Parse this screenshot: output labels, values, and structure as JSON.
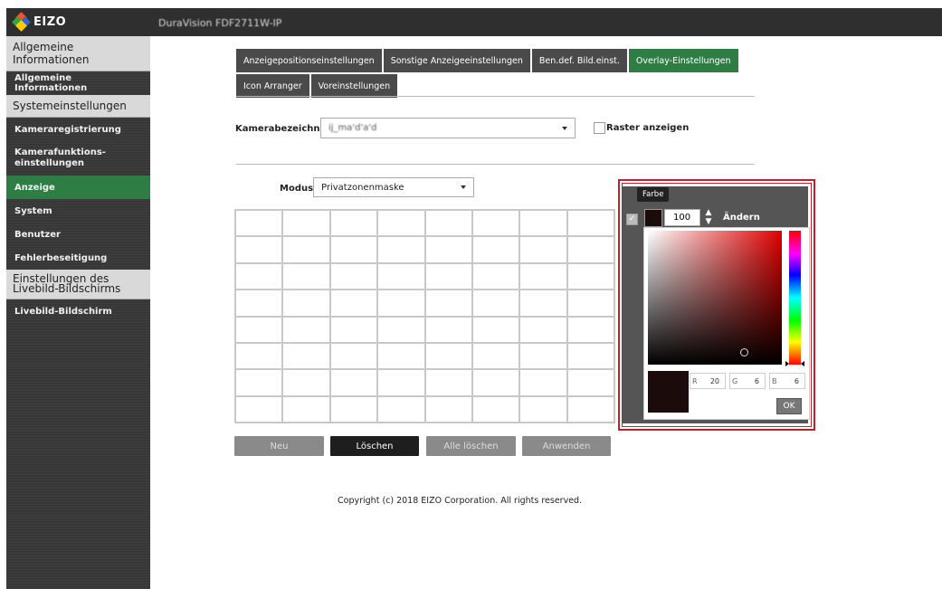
{
  "header": {
    "logo_text": "EIZO",
    "device_name": "DuraVision FDF2711W-IP"
  },
  "sidebar": {
    "sections": [
      {
        "label": "Allgemeine Informationen",
        "items": [
          "Allgemeine Informationen"
        ]
      },
      {
        "label": "Systemeinstellungen",
        "items": [
          "Kameraregistrierung",
          "Kamerafunktions-\neinstellungen",
          "Anzeige",
          "System",
          "Benutzer",
          "Fehlerbeseitigung"
        ]
      },
      {
        "label": "Einstellungen des Livebild-Bildschirms",
        "items": [
          "Livebild-Bildschirm"
        ]
      }
    ],
    "active_item": "Anzeige"
  },
  "tabs": {
    "row1": [
      "Anzeigepositionseinstellungen",
      "Sonstige Anzeigeeinstellungen",
      "Ben.def. Bild.einst.",
      "Overlay-Einstellungen"
    ],
    "row2": [
      "Icon Arranger",
      "Voreinstellungen"
    ],
    "active": "Overlay-Einstellungen"
  },
  "camera": {
    "label": "Kamerabezeichnung",
    "value": "ij_ma'd'a'd"
  },
  "raster": {
    "label": "Raster anzeigen",
    "checked": false
  },
  "modus": {
    "label": "Modus",
    "value": "Privatzonenmaske"
  },
  "grid": {
    "rows": 8,
    "cols": 8
  },
  "buttons": {
    "neu": "Neu",
    "loeschen": "Löschen",
    "alle_loeschen": "Alle löschen",
    "anwenden": "Anwenden"
  },
  "footer": {
    "copyright": "Copyright (c) 2018 EIZO Corporation. All rights reserved."
  },
  "overlay": {
    "tooltip": "Farbe",
    "opacity_value": "100",
    "change_label": "Ändern",
    "color_hex": "#140606",
    "r_label": "R",
    "r_value": "20",
    "g_label": "G",
    "g_value": "6",
    "b_label": "B",
    "b_value": "6",
    "ok_label": "OK",
    "accent_color": "#2e7d45",
    "highlight_color": "#c0202a"
  }
}
